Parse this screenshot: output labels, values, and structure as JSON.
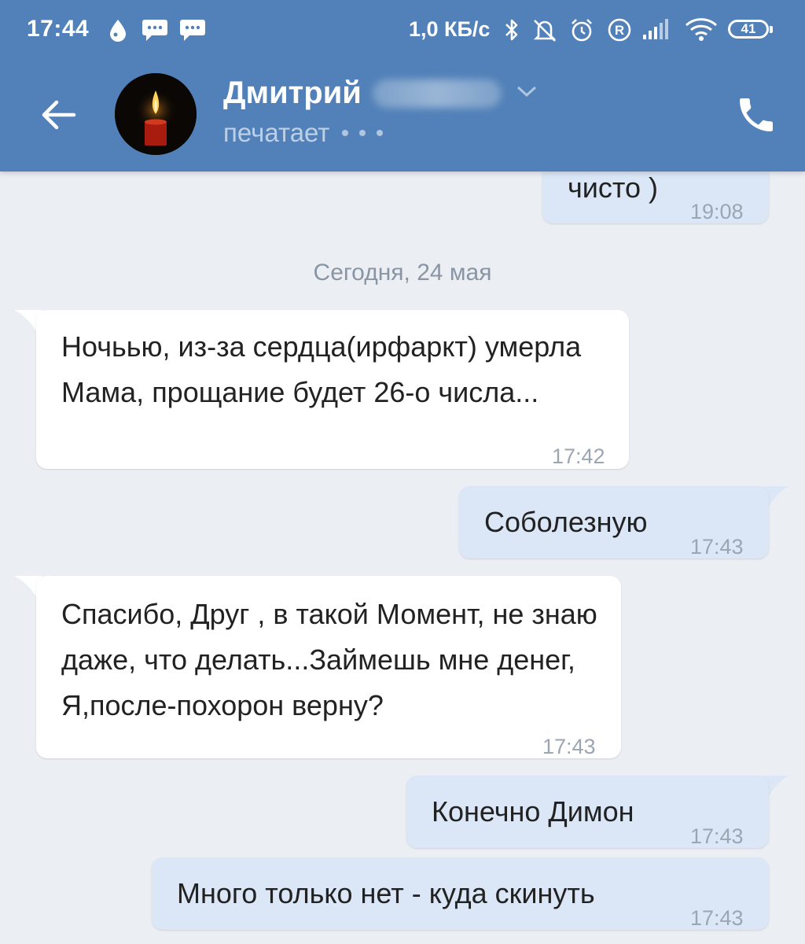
{
  "status_bar": {
    "time": "17:44",
    "speed": "1,0 КБ/с",
    "battery": "41",
    "icons": [
      "drop-icon",
      "message-icon",
      "message-icon",
      "bluetooth-icon",
      "bell-off-icon",
      "alarm-icon",
      "r-icon",
      "signal-icon",
      "wifi-icon",
      "battery-icon"
    ]
  },
  "header": {
    "contact_name": "Дмитрий",
    "status": "печатает",
    "icons": [
      "back-arrow-icon",
      "avatar",
      "chevron-down-icon",
      "phone-icon"
    ]
  },
  "messages": [
    {
      "direction": "out",
      "text": "чисто )",
      "time": "19:08"
    },
    {
      "direction": "separator",
      "text": "Сегодня, 24 мая"
    },
    {
      "direction": "in",
      "text": "Ночьью, из-за сердца(ирфаркт) умерла Мама, прощание будет 26-о числа...",
      "time": "17:42"
    },
    {
      "direction": "out",
      "text": "Соболезную",
      "time": "17:43"
    },
    {
      "direction": "in",
      "text": "Спасибо, Друг , в такой Момент, не знаю даже, что делать...Займешь мне денег, Я,после-похорон верну?",
      "time": "17:43"
    },
    {
      "direction": "out",
      "text": "Конечно Димон",
      "time": "17:43"
    },
    {
      "direction": "out",
      "text": "Много только нет - куда скинуть",
      "time": "17:43"
    }
  ],
  "colors": {
    "header": "#5181b8",
    "background": "#ebeff4",
    "incoming_bubble": "#ffffff",
    "outgoing_bubble": "#dbe7f6",
    "time_text": "#9ba6b3"
  }
}
